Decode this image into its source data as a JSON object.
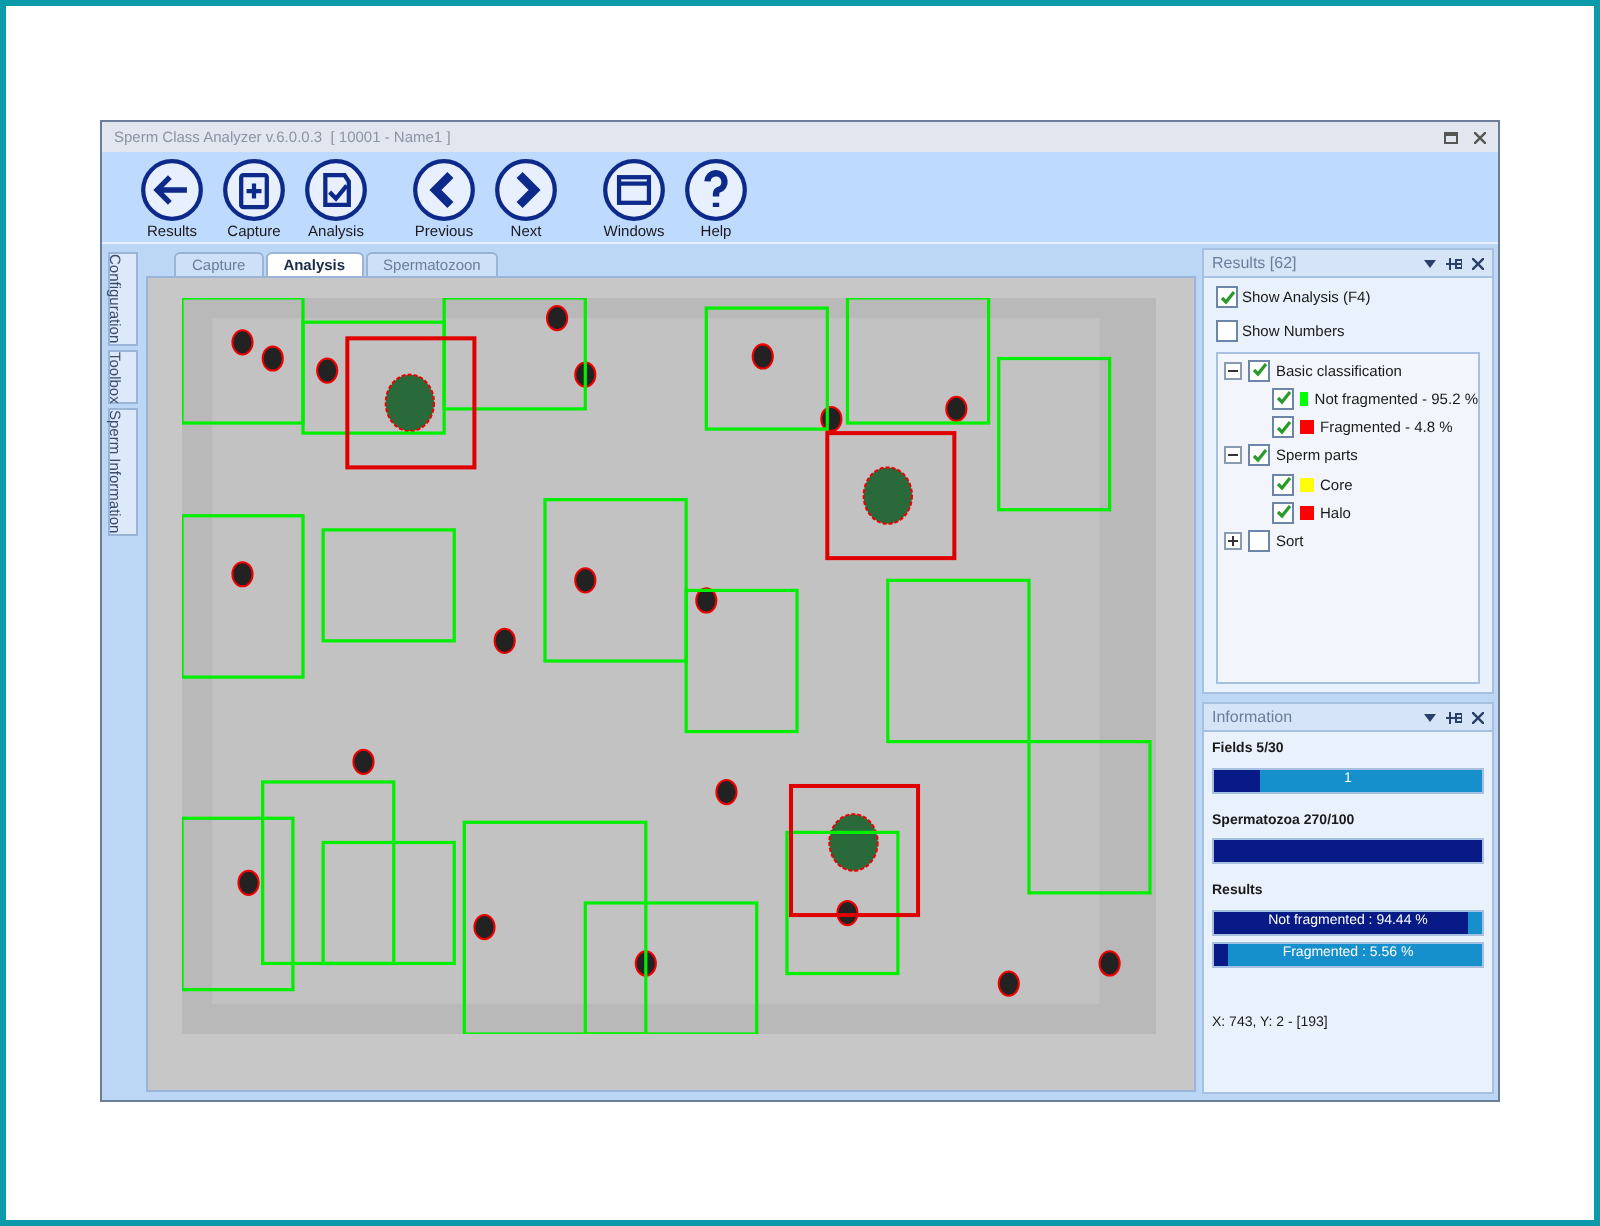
{
  "window": {
    "title": "Sperm Class Analyzer v.6.0.0.3  [ 10001 - Name1 ]"
  },
  "toolbar": [
    {
      "label": "Results",
      "kind": "back"
    },
    {
      "label": "Capture",
      "kind": "capture"
    },
    {
      "label": "Analysis",
      "kind": "analysis"
    },
    {
      "label": "Previous",
      "kind": "previous"
    },
    {
      "label": "Next",
      "kind": "next"
    },
    {
      "label": "Windows",
      "kind": "windows"
    },
    {
      "label": "Help",
      "kind": "help"
    }
  ],
  "side_tabs": [
    {
      "label": "Configuration"
    },
    {
      "label": "Toolbox"
    },
    {
      "label": "Sperm Information"
    }
  ],
  "doc_tabs": [
    {
      "label": "Capture",
      "selected": false
    },
    {
      "label": "Analysis",
      "selected": true
    },
    {
      "label": "Spermatozoon",
      "selected": false
    }
  ],
  "results_panel": {
    "title": "Results [62]",
    "options": [
      {
        "label": "Show Analysis (F4)",
        "checked": true
      },
      {
        "label": "Show Numbers",
        "checked": false
      }
    ],
    "tree": [
      {
        "label": "Basic classification",
        "checked": true,
        "expanded": true,
        "children": [
          {
            "label": "Not fragmented - 95.2 %",
            "checked": true,
            "color": "#00ff00"
          },
          {
            "label": "Fragmented - 4.8 %",
            "checked": true,
            "color": "#ff0000"
          }
        ]
      },
      {
        "label": "Sperm parts",
        "checked": true,
        "expanded": true,
        "children": [
          {
            "label": "Core",
            "checked": true,
            "color": "#ffff00"
          },
          {
            "label": "Halo",
            "checked": true,
            "color": "#ff0000"
          }
        ]
      },
      {
        "label": "Sort",
        "checked": false,
        "expanded": false
      }
    ]
  },
  "information_panel": {
    "title": "Information",
    "sections": [
      {
        "heading": "Fields 5/30",
        "bars": [
          {
            "level": 0.17,
            "text": "1"
          }
        ]
      },
      {
        "heading": "Spermatozoa 270/100",
        "bars": [
          {
            "level": 1
          }
        ]
      },
      {
        "heading": "Results",
        "bars": [
          {
            "level": 0.95,
            "text": "Not fragmented : 94.44 %"
          },
          {
            "level": 0.05,
            "text": "Fragmented : 5.56 %"
          }
        ]
      }
    ],
    "coordinates": "X: 743, Y: 2 - [193]"
  }
}
